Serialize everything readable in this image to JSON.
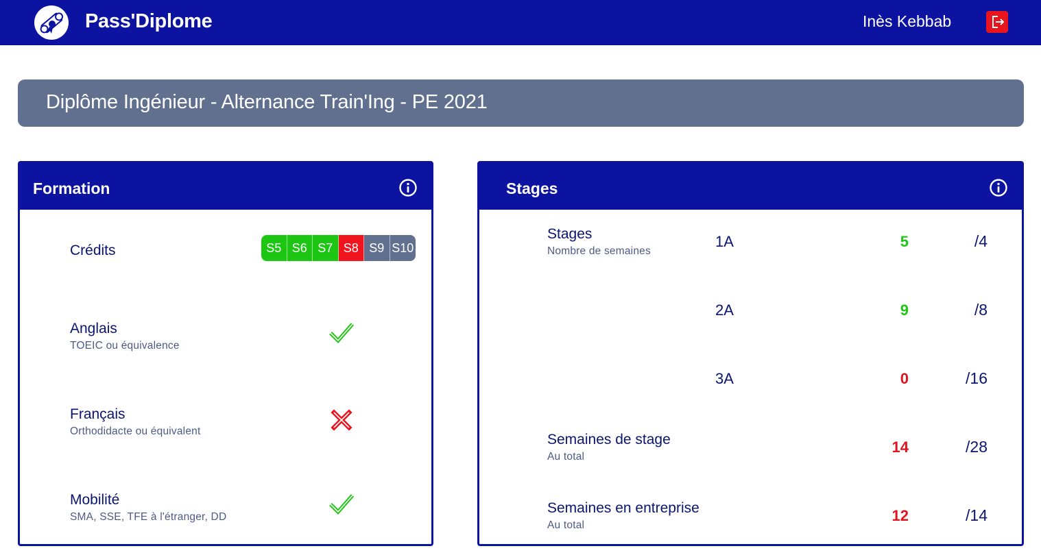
{
  "header": {
    "app_title": "Pass'Diplome",
    "user_name": "Inès Kebbab",
    "logo_icon": "diploma-scroll-icon",
    "logout_icon": "logout-icon",
    "bar_color": "#0c13a0",
    "logout_color": "#e8141e"
  },
  "program": {
    "title": "Diplôme Ingénieur - Alternance Train'Ing - PE 2021"
  },
  "formation": {
    "title": "Formation",
    "info_icon": "info-icon",
    "credits": {
      "label": "Crédits",
      "semesters": [
        {
          "label": "S5",
          "status": "validated",
          "color": "#1ec614"
        },
        {
          "label": "S6",
          "status": "validated",
          "color": "#1ec614"
        },
        {
          "label": "S7",
          "status": "validated",
          "color": "#1ec614"
        },
        {
          "label": "S8",
          "status": "failed",
          "color": "#f0141e"
        },
        {
          "label": "S9",
          "status": "pending",
          "color": "#61708f"
        },
        {
          "label": "S10",
          "status": "pending",
          "color": "#61708f"
        }
      ]
    },
    "rows": [
      {
        "label": "Anglais",
        "sub": "TOEIC ou équivalence",
        "status": "validated",
        "icon": "checkmark-icon"
      },
      {
        "label": "Français",
        "sub": "Orthodidacte ou équivalent",
        "status": "failed",
        "icon": "cross-icon"
      },
      {
        "label": "Mobilité",
        "sub": "SMA, SSE, TFE à l'étranger, DD",
        "status": "validated",
        "icon": "checkmark-icon"
      }
    ]
  },
  "stages": {
    "title": "Stages",
    "info_icon": "info-icon",
    "weeks_group": {
      "label": "Stages",
      "sub": "Nombre de semaines",
      "rows": [
        {
          "year": "1A",
          "value": "5",
          "total": "/4",
          "status": "ok"
        },
        {
          "year": "2A",
          "value": "9",
          "total": "/8",
          "status": "ok"
        },
        {
          "year": "3A",
          "value": "0",
          "total": "/16",
          "status": "ko"
        }
      ]
    },
    "totals": [
      {
        "label": "Semaines de stage",
        "sub": "Au total",
        "value": "14",
        "total": "/28",
        "status": "ko"
      },
      {
        "label": "Semaines en entreprise",
        "sub": "Au total",
        "value": "12",
        "total": "/14",
        "status": "ko"
      }
    ],
    "ok_color": "#1ec614",
    "ko_color": "#e0141e"
  }
}
